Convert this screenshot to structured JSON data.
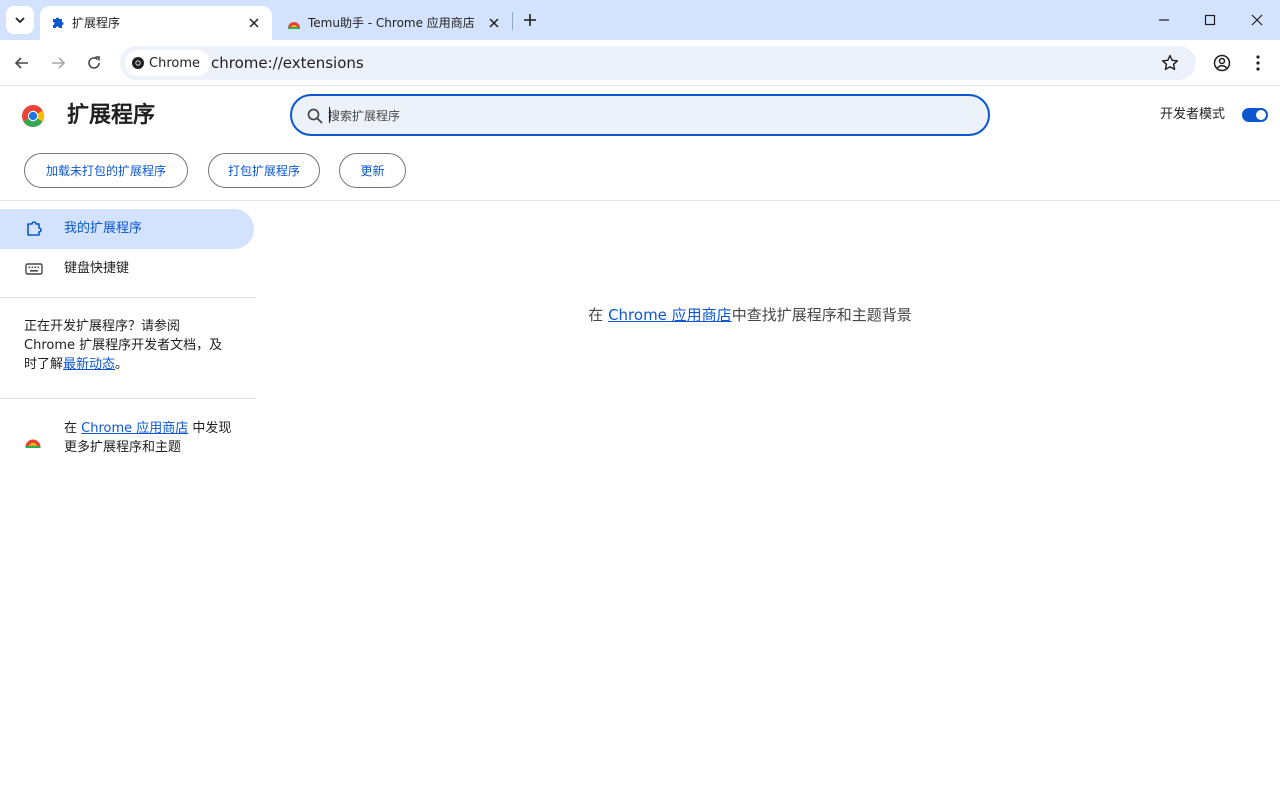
{
  "browser": {
    "tabs": [
      {
        "title": "扩展程序",
        "active": true
      },
      {
        "title": "Temu助手 - Chrome 应用商店",
        "active": false
      }
    ],
    "omnibox": {
      "chip_label": "Chrome",
      "url": "chrome://extensions"
    }
  },
  "extensions": {
    "title": "扩展程序",
    "search_placeholder": "搜索扩展程序",
    "developer_mode_label": "开发者模式",
    "developer_mode_on": true,
    "actions": {
      "load_unpacked": "加载未打包的扩展程序",
      "pack": "打包扩展程序",
      "update": "更新"
    }
  },
  "sidebar": {
    "items": [
      {
        "label": "我的扩展程序",
        "selected": true
      },
      {
        "label": "键盘快捷键",
        "selected": false
      }
    ],
    "dev_note": {
      "text_before": "正在开发扩展程序？请参阅 Chrome 扩展程序开发者文档，及时了解",
      "link": "最新动态",
      "text_after": "。"
    },
    "store_promo": {
      "text_before": "在 ",
      "link": "Chrome 应用商店",
      "text_after": " 中发现更多扩展程序和主题"
    }
  },
  "main": {
    "text_before": "在 ",
    "link": "Chrome 应用商店",
    "text_after": "中查找扩展程序和主题背景"
  },
  "colors": {
    "accent": "#0b57d0",
    "tabstrip": "#d3e3fd",
    "omnibox_bg": "#edf2fa"
  }
}
